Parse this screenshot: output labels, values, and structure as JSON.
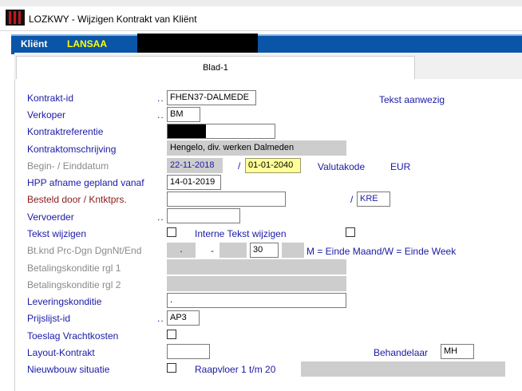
{
  "window": {
    "title": "LOZKWY - Wijzigen Kontrakt van Kliënt"
  },
  "banner": {
    "label": "Kliënt",
    "value": "LANSAA"
  },
  "tabs": [
    {
      "label": "Blad-1"
    }
  ],
  "form": {
    "kontrakt_id": {
      "label": "Kontrakt-id",
      "dots": "..",
      "value": "FHEN37-DALMEDE"
    },
    "tekst_aanwezig": "Tekst aanwezig",
    "verkoper": {
      "label": "Verkoper",
      "dots": "..",
      "value": "BM"
    },
    "kontraktreferentie": {
      "label": "Kontraktreferentie"
    },
    "kontraktomschrijving": {
      "label": "Kontraktomschrijving",
      "value": "Hengelo, div. werken Dalmeden"
    },
    "begin_einddatum": {
      "label": "Begin- / Einddatum",
      "begin": "22-11-2018",
      "sep": "/",
      "eind": "01-01-2040"
    },
    "valutakode": {
      "label": "Valutakode",
      "value": "EUR"
    },
    "hpp_afname": {
      "label": "HPP afname gepland vanaf",
      "value": "14-01-2019"
    },
    "besteld_door": {
      "label": "Besteld door / Kntktprs.",
      "sep": "/",
      "kntktprs": "KRE"
    },
    "vervoerder": {
      "label": "Vervoerder",
      "dots": ".."
    },
    "tekst_wijzigen": {
      "label": "Tekst wijzigen"
    },
    "interne_tekst_wijzigen": {
      "label": "Interne Tekst wijzigen"
    },
    "bt_knd": {
      "label": "Bt.knd Prc-Dgn DgnNt/End",
      "field1": ".",
      "dash": "-",
      "days": "30",
      "hint": "M = Einde Maand/W = Einde Week"
    },
    "betalingskonditie_1": {
      "label": "Betalingskonditie rgl 1"
    },
    "betalingskonditie_2": {
      "label": "Betalingskonditie rgl 2"
    },
    "leveringskonditie": {
      "label": "Leveringskonditie",
      "value": "."
    },
    "prijslijst_id": {
      "label": "Prijslijst-id",
      "dots": "..",
      "value": "AP3"
    },
    "toeslag_vrachtkosten": {
      "label": "Toeslag Vrachtkosten"
    },
    "layout_kontrakt": {
      "label": "Layout-Kontrakt"
    },
    "behandelaar": {
      "label": "Behandelaar",
      "value": "MH"
    },
    "nieuwbouw_situatie": {
      "label": "Nieuwbouw situatie"
    },
    "raapvloer": {
      "label": "Raapvloer 1 t/m 20"
    }
  },
  "colors": {
    "label_blue": "#1a1aa6",
    "banner_blue": "#0a55a8",
    "banner_value": "#ffff00",
    "highlight_yellow": "#ffff99",
    "disabled_gray": "#cdcdcd",
    "required_red": "#8b1a1a"
  }
}
